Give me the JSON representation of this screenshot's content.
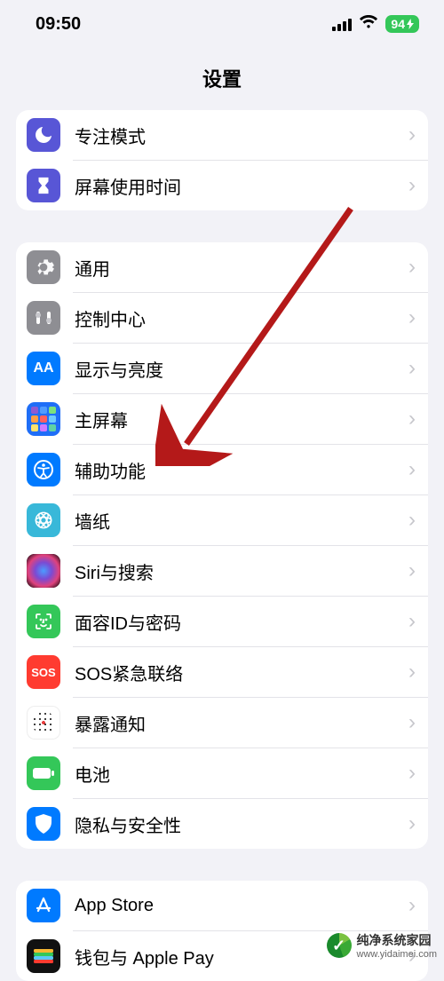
{
  "status": {
    "time": "09:50",
    "battery": "94"
  },
  "header": {
    "title": "设置"
  },
  "group1": [
    {
      "label": "专注模式"
    },
    {
      "label": "屏幕使用时间"
    }
  ],
  "group2": [
    {
      "label": "通用"
    },
    {
      "label": "控制中心"
    },
    {
      "label": "显示与亮度"
    },
    {
      "label": "主屏幕"
    },
    {
      "label": "辅助功能"
    },
    {
      "label": "墙纸"
    },
    {
      "label": "Siri与搜索"
    },
    {
      "label": "面容ID与密码"
    },
    {
      "label": "SOS紧急联络"
    },
    {
      "label": "暴露通知"
    },
    {
      "label": "电池"
    },
    {
      "label": "隐私与安全性"
    }
  ],
  "group3": [
    {
      "label": "App Store"
    },
    {
      "label": "钱包与 Apple Pay"
    }
  ],
  "sos_text": "SOS",
  "watermark": {
    "brand": "纯净系统家园",
    "url": "www.yidaimei.com"
  },
  "arrow": {
    "color": "#b41919"
  }
}
